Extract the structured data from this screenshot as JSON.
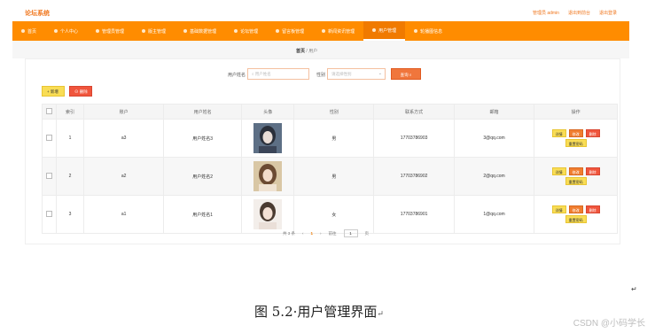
{
  "header": {
    "brand": "论坛系统",
    "links": [
      "管理员 admin",
      "退出到前台",
      "退出登录"
    ]
  },
  "nav": {
    "items": [
      "首页",
      "个人中心",
      "管理员管理",
      "版主管理",
      "基础数据管理",
      "论坛管理",
      "留言板管理",
      "新闻资讯管理",
      "用户管理",
      "轮播图信息"
    ],
    "active_index": 8
  },
  "breadcrumb": {
    "home": "首页",
    "sep": "/",
    "current": "用户"
  },
  "search": {
    "name_label": "用户姓名",
    "name_placeholder": "用户姓名",
    "gender_label": "性别",
    "gender_placeholder": "请选择性别",
    "button": "查询"
  },
  "toolbar": {
    "add": "新增",
    "delete": "删除"
  },
  "table": {
    "headers": [
      "",
      "索引",
      "账户",
      "用户姓名",
      "头像",
      "性别",
      "联系方式",
      "邮箱",
      "操作"
    ],
    "rows": [
      {
        "index": "1",
        "account": "a3",
        "name": "用户姓名3",
        "gender": "男",
        "phone": "17703786903",
        "email": "3@qq.com"
      },
      {
        "index": "2",
        "account": "a2",
        "name": "用户姓名2",
        "gender": "男",
        "phone": "17703786902",
        "email": "2@qq.com"
      },
      {
        "index": "3",
        "account": "a1",
        "name": "用户姓名1",
        "gender": "女",
        "phone": "17703786901",
        "email": "1@qq.com"
      }
    ],
    "row_actions": {
      "detail": "详情",
      "edit": "修改",
      "delete": "删除",
      "reset": "重置密码"
    }
  },
  "pager": {
    "total": "共 3 条",
    "prev": "‹",
    "page": "1",
    "next": "›",
    "goto": "前往",
    "page_input": "1",
    "unit": "页"
  },
  "doc": {
    "caption": "图 5.2·用户管理界面",
    "watermark": "CSDN @小码学长"
  },
  "colors": {
    "nav_bg": "#ff8c00",
    "brand": "#f0761d",
    "danger": "#f0553c",
    "warning": "#f9dd55"
  }
}
